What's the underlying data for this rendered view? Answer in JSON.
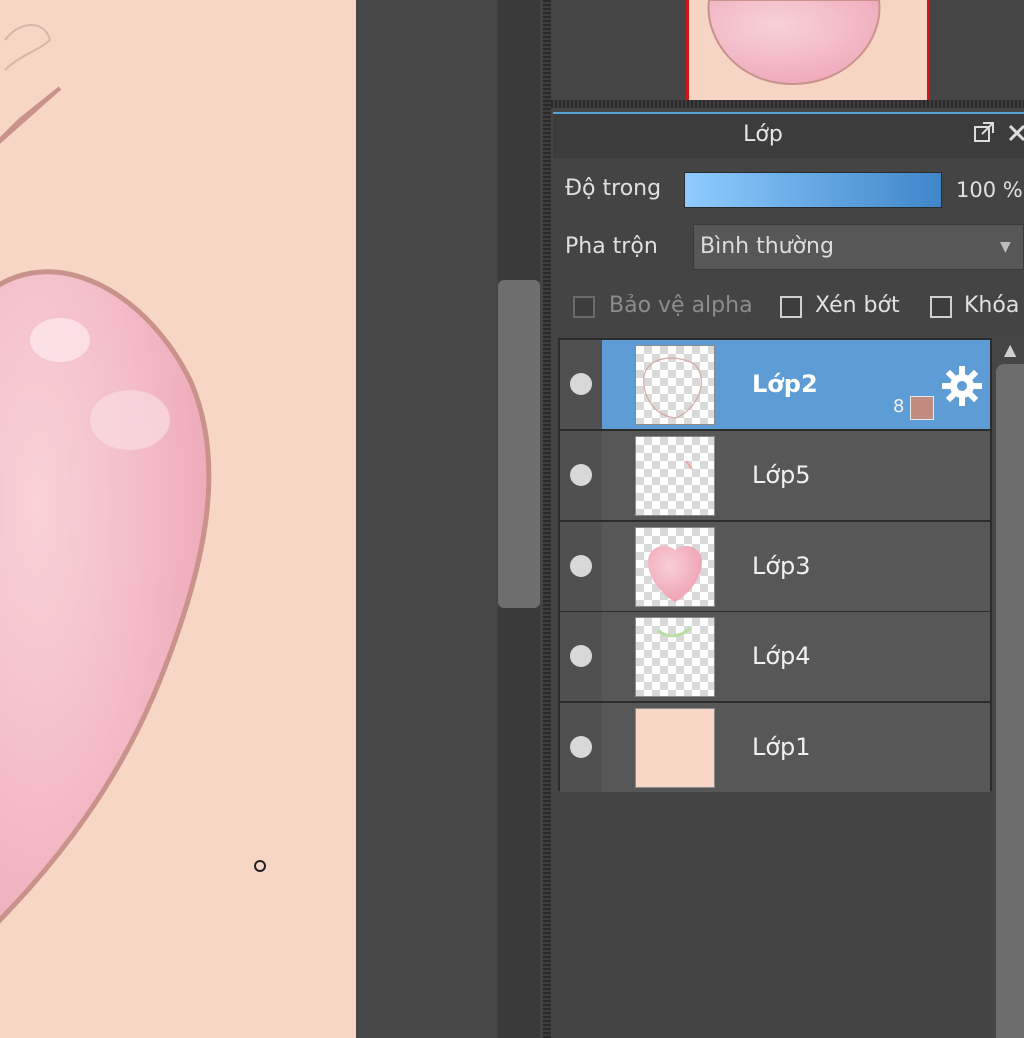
{
  "colors": {
    "canvas_bg": "#f7d6c6",
    "selection": "#5d9cd4",
    "panel_bg": "#444444",
    "opacity_bar_start": "#8fcbff",
    "opacity_bar_end": "#3f86c9"
  },
  "layer_panel": {
    "title": "Lớp",
    "popout_icon": "popout-icon",
    "close_icon": "close-icon",
    "opacity_label": "Độ trong",
    "opacity_value": "100 %",
    "opacity_fraction": 1.0,
    "blend_label": "Pha trộn",
    "blend_value": "Bình thường",
    "checkboxes": [
      {
        "label": "Bảo vệ alpha",
        "checked": false,
        "enabled": false
      },
      {
        "label": "Xén bớt",
        "checked": false,
        "enabled": true
      },
      {
        "label": "Khóa",
        "checked": false,
        "enabled": true
      }
    ],
    "layers": [
      {
        "name": "Lớp2",
        "selected": true,
        "badge": "8",
        "icon": "gear-icon"
      },
      {
        "name": "Lớp5",
        "selected": false
      },
      {
        "name": "Lớp3",
        "selected": false
      },
      {
        "name": "Lớp4",
        "selected": false
      },
      {
        "name": "Lớp1",
        "selected": false
      }
    ]
  }
}
